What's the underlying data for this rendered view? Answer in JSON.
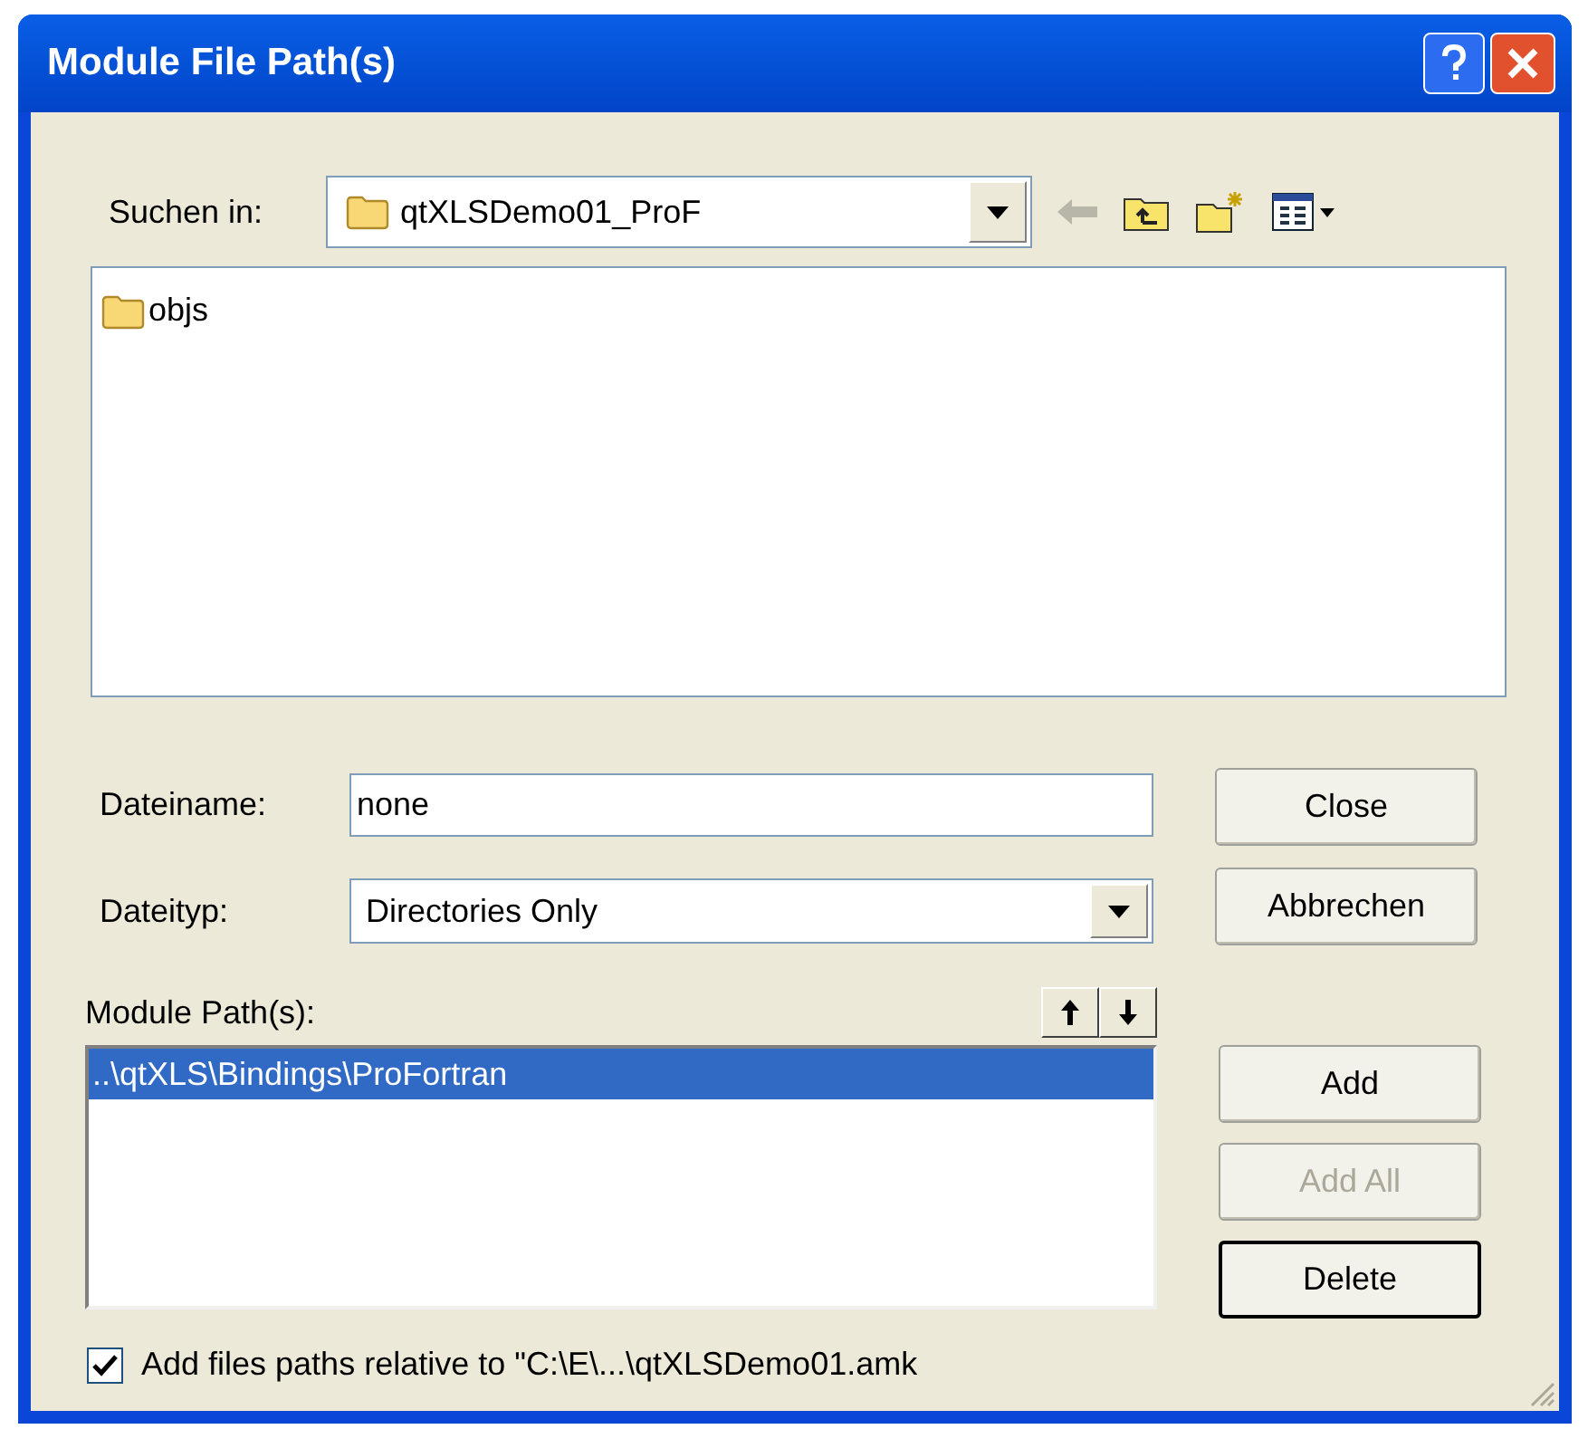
{
  "window": {
    "title": "Module File Path(s)"
  },
  "look_in": {
    "label": "Suchen in:",
    "value": "qtXLSDemo01_ProF"
  },
  "file_list": {
    "items": [
      {
        "name": "objs"
      }
    ]
  },
  "file_name": {
    "label": "Dateiname:",
    "value": "none"
  },
  "file_type": {
    "label": "Dateityp:",
    "value": "Directories Only"
  },
  "top_buttons": [
    {
      "label": "Close",
      "disabled": false,
      "default": false
    },
    {
      "label": "Abbrechen",
      "disabled": false,
      "default": false
    }
  ],
  "module_paths": {
    "label": "Module Path(s):",
    "items": [
      {
        "text": "..\\qtXLS\\Bindings\\ProFortran",
        "selected": true
      }
    ]
  },
  "side_buttons": [
    {
      "label": "Add",
      "disabled": false,
      "default": false
    },
    {
      "label": "Add All",
      "disabled": true,
      "default": false
    },
    {
      "label": "Delete",
      "disabled": false,
      "default": true
    }
  ],
  "relative_option": {
    "label": "Add files paths relative to \"C:\\E\\...\\qtXLSDemo01.amk",
    "checked": true
  }
}
